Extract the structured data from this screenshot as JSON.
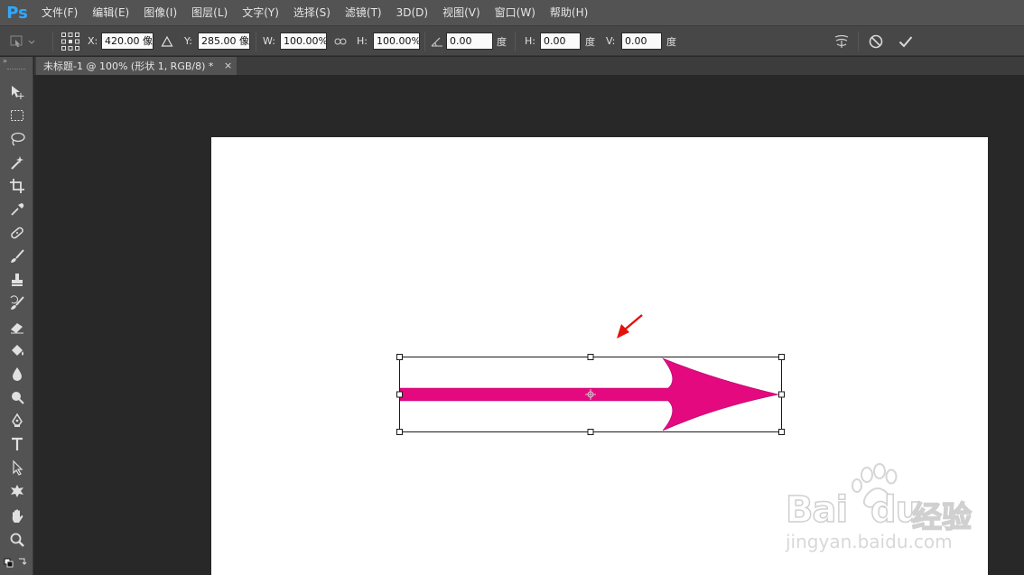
{
  "app": {
    "logo": "Ps"
  },
  "menu": [
    "文件(F)",
    "编辑(E)",
    "图像(I)",
    "图层(L)",
    "文字(Y)",
    "选择(S)",
    "滤镜(T)",
    "3D(D)",
    "视图(V)",
    "窗口(W)",
    "帮助(H)"
  ],
  "options": {
    "x_label": "X:",
    "x_value": "420.00 像",
    "y_label": "Y:",
    "y_value": "285.00 像",
    "w_label": "W:",
    "w_value": "100.00%",
    "h_label": "H:",
    "h_value": "100.00%",
    "angle_value": "0.00",
    "angle_unit": "度",
    "skew_h_label": "H:",
    "skew_h_value": "0.00",
    "skew_h_unit": "度",
    "skew_v_label": "V:",
    "skew_v_value": "0.00",
    "skew_v_unit": "度"
  },
  "document": {
    "tab_title": "未标题-1 @ 100% (形状 1, RGB/8) *",
    "tab_close": "×"
  },
  "shape": {
    "fill_color": "#e4097f",
    "annotation_color": "#e3120b"
  },
  "watermark": {
    "brand": "Bai  du",
    "brand_cn": "经验",
    "url": "jingyan.baidu.com"
  },
  "tools": [
    "move-tool",
    "marquee-tool",
    "lasso-tool",
    "magic-wand-tool",
    "crop-tool",
    "eyedropper-tool",
    "healing-brush-tool",
    "brush-tool",
    "clone-stamp-tool",
    "history-brush-tool",
    "eraser-tool",
    "paint-bucket-tool",
    "blur-tool",
    "dodge-tool",
    "pen-tool",
    "type-tool",
    "path-selection-tool",
    "custom-shape-tool",
    "hand-tool",
    "zoom-tool",
    "swap-colors-tool"
  ]
}
